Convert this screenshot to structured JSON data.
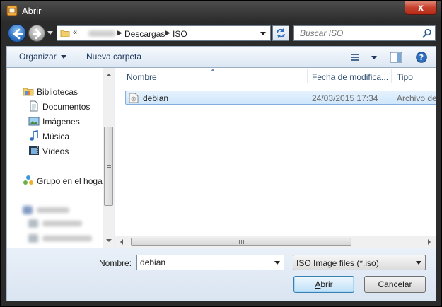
{
  "window": {
    "title": "Abrir",
    "close_label": "x"
  },
  "address": {
    "root_chevron": "«",
    "separator": "▶",
    "crumbs": [
      "Descargas",
      "ISO"
    ]
  },
  "search": {
    "placeholder": "Buscar ISO"
  },
  "toolbar": {
    "organize_label": "Organizar",
    "new_folder_label": "Nueva carpeta",
    "view_icon": "view-list-icon",
    "preview_icon": "preview-pane-icon",
    "help_icon": "help-icon"
  },
  "sidebar": {
    "items": [
      {
        "label": "Bibliotecas",
        "icon": "library-icon"
      },
      {
        "label": "Documentos",
        "icon": "documents-icon"
      },
      {
        "label": "Imágenes",
        "icon": "pictures-icon"
      },
      {
        "label": "Música",
        "icon": "music-icon"
      },
      {
        "label": "Vídeos",
        "icon": "videos-icon"
      },
      {
        "label": "Grupo en el hogar",
        "icon": "homegroup-icon"
      }
    ]
  },
  "file_list": {
    "columns": [
      "Nombre",
      "Fecha de modifica...",
      "Tipo"
    ],
    "rows": [
      {
        "name": "debian",
        "modified": "24/03/2015 17:34",
        "type": "Archivo de"
      }
    ]
  },
  "footer": {
    "name_label_prefix": "N",
    "name_label_accel": "o",
    "name_label_suffix": "mbre:",
    "name_value": "debian",
    "type_filter": "ISO Image files (*.iso)",
    "open_label_accel": "A",
    "open_label_rest": "brir",
    "cancel_label": "Cancelar"
  },
  "colors": {
    "accent": "#3c7fb1",
    "selection": "#cfe6fb",
    "close": "#c7432f"
  }
}
